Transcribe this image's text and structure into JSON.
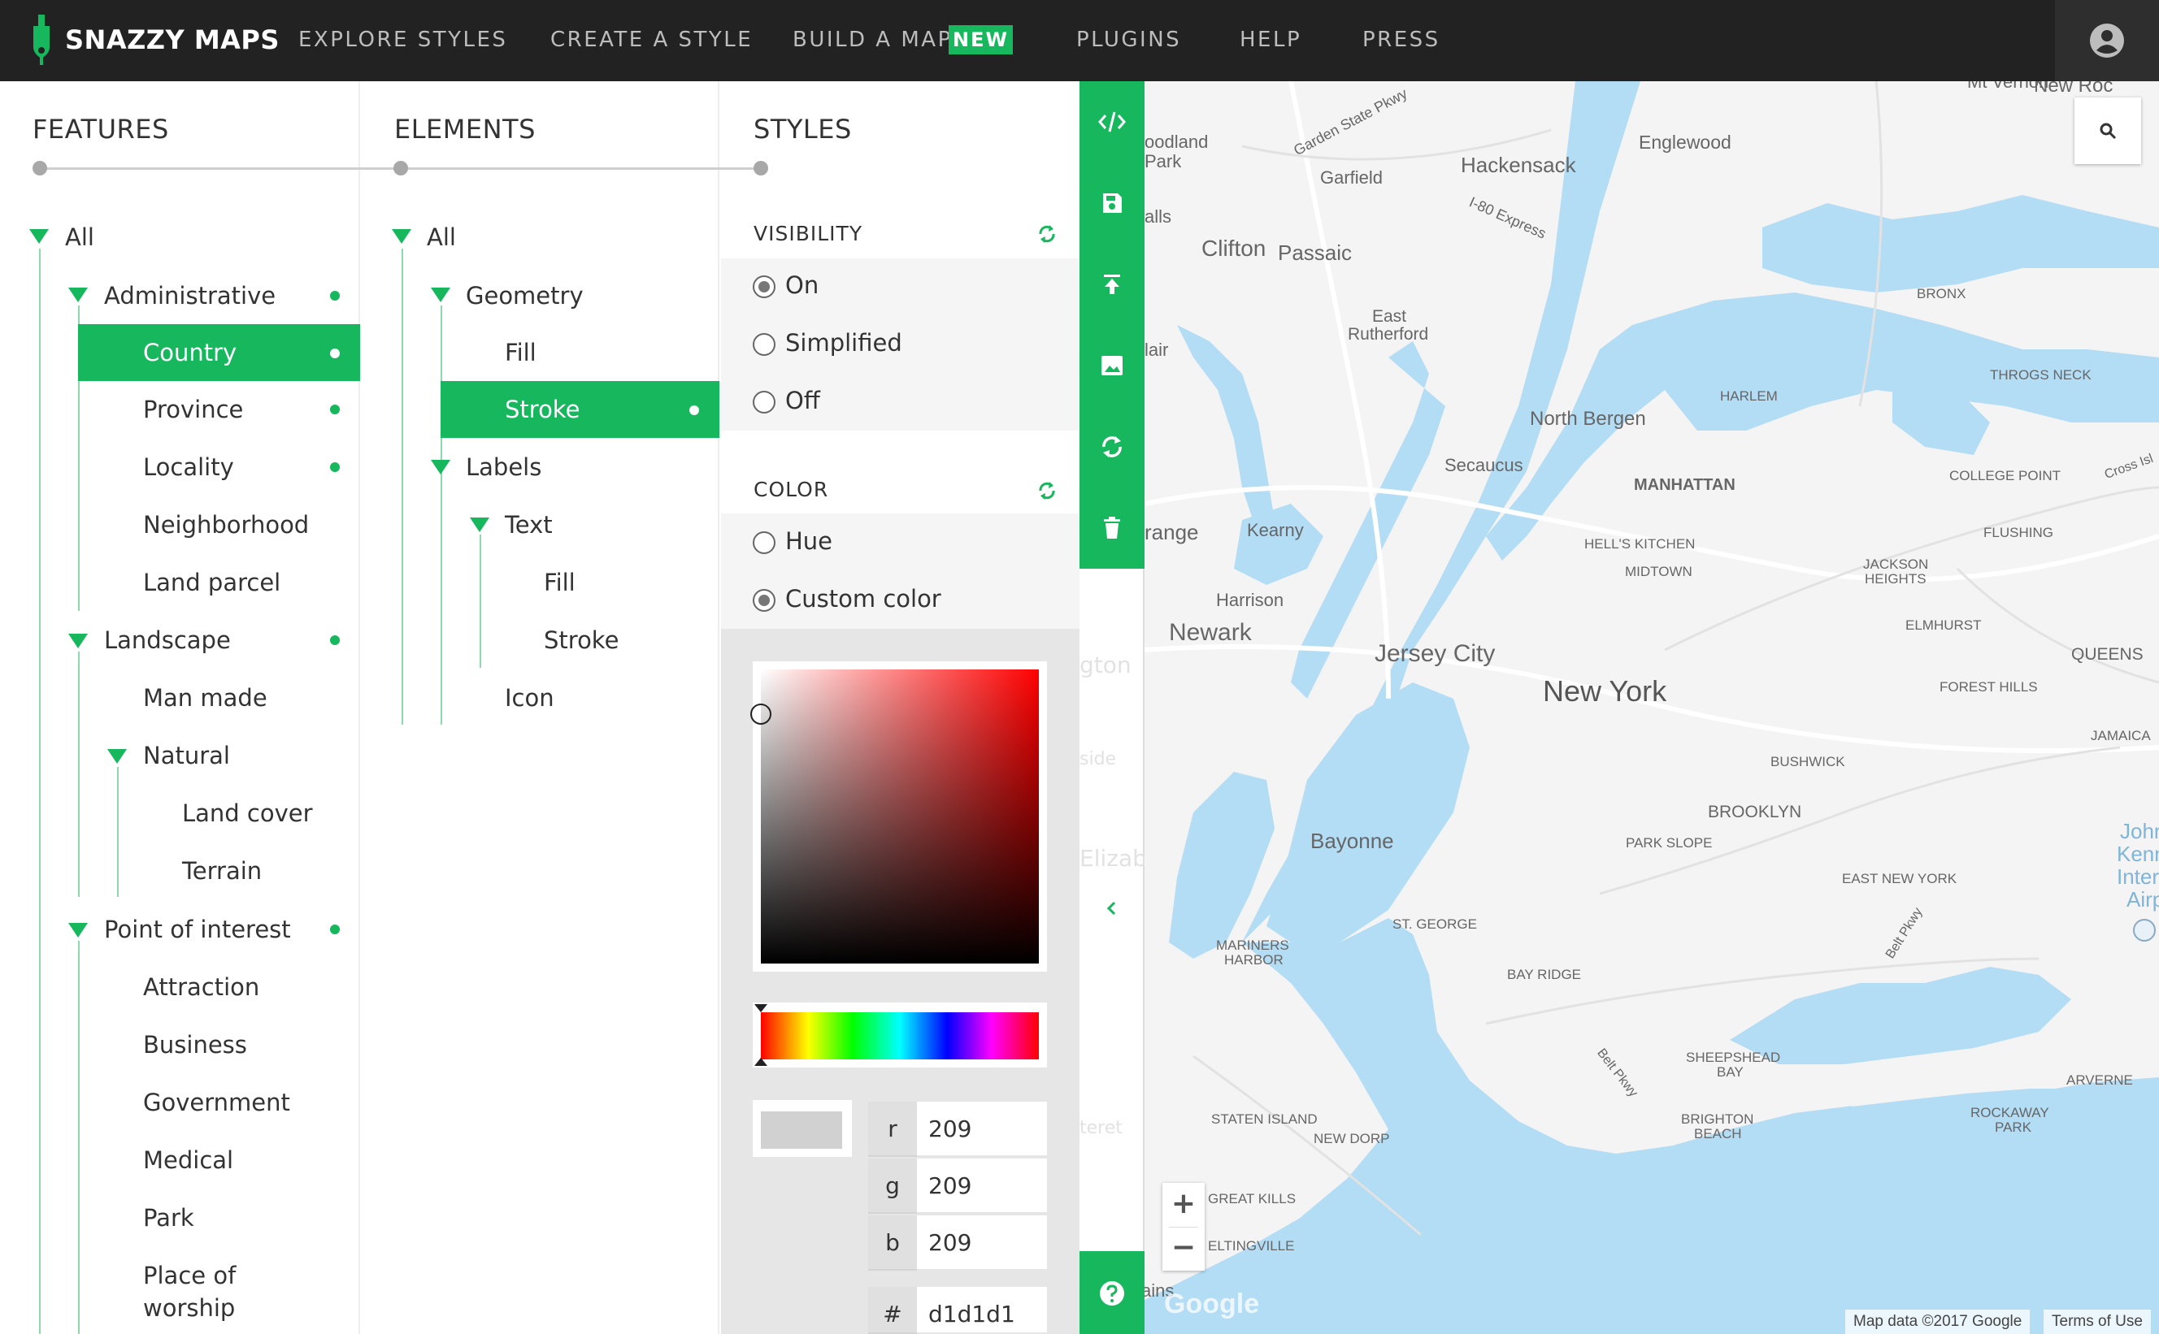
{
  "brand": {
    "name": "SNAZZY MAPS"
  },
  "nav": {
    "explore": "EXPLORE STYLES",
    "create": "CREATE A STYLE",
    "build": "BUILD A MAP",
    "build_badge": "NEW",
    "plugins": "PLUGINS",
    "help": "HELP",
    "press": "PRESS"
  },
  "columns": {
    "features": "FEATURES",
    "elements": "ELEMENTS",
    "styles": "STYLES"
  },
  "features": {
    "all": "All",
    "administrative": "Administrative",
    "country": "Country",
    "province": "Province",
    "locality": "Locality",
    "neighborhood": "Neighborhood",
    "land_parcel": "Land parcel",
    "landscape": "Landscape",
    "man_made": "Man made",
    "natural": "Natural",
    "land_cover": "Land cover",
    "terrain": "Terrain",
    "poi": "Point of interest",
    "attraction": "Attraction",
    "business": "Business",
    "government": "Government",
    "medical": "Medical",
    "park": "Park",
    "worship_1": "Place of",
    "worship_2": "worship"
  },
  "elements": {
    "all": "All",
    "geometry": "Geometry",
    "geo_fill": "Fill",
    "geo_stroke": "Stroke",
    "labels": "Labels",
    "text": "Text",
    "text_fill": "Fill",
    "text_stroke": "Stroke",
    "icon": "Icon"
  },
  "styles": {
    "visibility": {
      "heading": "VISIBILITY",
      "on": "On",
      "simplified": "Simplified",
      "off": "Off",
      "selected": "On"
    },
    "color": {
      "heading": "COLOR",
      "hue": "Hue",
      "custom": "Custom color",
      "selected": "Custom color"
    },
    "picker": {
      "r": "209",
      "g": "209",
      "b": "209",
      "hex": "d1d1d1",
      "r_label": "r",
      "g_label": "g",
      "b_label": "b",
      "hex_label": "#",
      "swatch_color": "#d1d1d1"
    }
  },
  "map": {
    "labels": {
      "mt_vernon": "Mt Vernon",
      "new_roc": "New Roc",
      "woodland": "oodland",
      "park": "Park",
      "garden_state": "Garden State Pkwy",
      "englewood": "Englewood",
      "hackensack": "Hackensack",
      "garfield": "Garfield",
      "falls": "alls",
      "i80": "I-80 Express",
      "clifton": "Clifton",
      "passaic": "Passaic",
      "bronx": "BRONX",
      "east_rutherford_1": "East",
      "east_rutherford_2": "Rutherford",
      "lair": "lair",
      "throgs": "THROGS NECK",
      "harlem": "HARLEM",
      "north_bergen": "North Bergen",
      "secaucus": "Secaucus",
      "manhattan": "MANHATTAN",
      "college_point": "COLLEGE POINT",
      "cross_isl": "Cross Isl",
      "orange": "range",
      "kearny": "Kearny",
      "hells_kitchen": "HELL'S KITCHEN",
      "flushing": "FLUSHING",
      "midtown": "MIDTOWN",
      "jackson_1": "JACKSON",
      "jackson_2": "HEIGHTS",
      "harrison": "Harrison",
      "elmhurst": "ELMHURST",
      "newark": "Newark",
      "jersey_city": "Jersey City",
      "queens": "QUEENS",
      "forest_hills": "FOREST HILLS",
      "new_york": "New York",
      "jamaica": "JAMAICA",
      "bushwick": "BUSHWICK",
      "brooklyn": "BROOKLYN",
      "bayonne": "Bayonne",
      "park_slope": "PARK SLOPE",
      "john_1": "John",
      "john_2": "Kenne",
      "john_3": "Internat",
      "john_4": "Airpo",
      "east_ny": "EAST NEW YORK",
      "st_george": "ST. GEORGE",
      "mariners_1": "MARINERS",
      "mariners_2": "HARBOR",
      "bay_ridge": "BAY RIDGE",
      "belt_pkwy": "Belt Pkwy",
      "belt_pkwy2": "Belt Pkwy",
      "sheepshead_1": "SHEEPSHEAD",
      "sheepshead_2": "BAY",
      "arverne": "ARVERNE",
      "staten_island": "STATEN ISLAND",
      "brighton_1": "BRIGHTON",
      "brighton_2": "BEACH",
      "rockaway_1": "ROCKAWAY",
      "rockaway_2": "PARK",
      "new_dorp": "NEW DORP",
      "great_kills": "GREAT KILLS",
      "eltingville": "ELTINGVILLE",
      "google": "Google",
      "plains": "ains"
    },
    "ghost": {
      "ton": "gton",
      "side": "side",
      "elizabeth": "Elizabeth",
      "teret": "teret"
    },
    "attribution": "Map data ©2017 Google",
    "terms": "Terms of Use",
    "zoom_in": "+",
    "zoom_out": "−"
  },
  "colors": {
    "accent": "#17b75e",
    "topbar": "#222222",
    "water": "#b3dcf5",
    "land": "#f4f4f4"
  }
}
